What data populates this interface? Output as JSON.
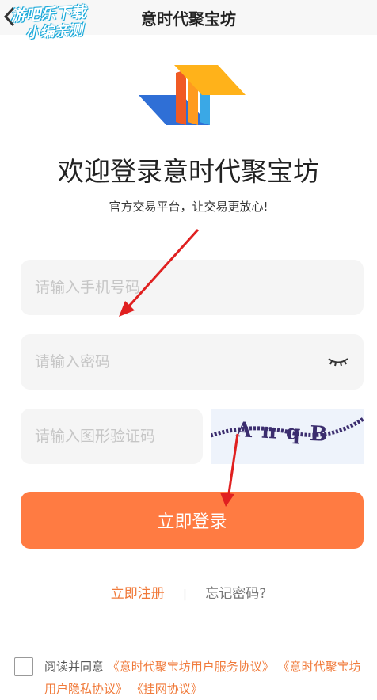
{
  "header": {
    "title": "意时代聚宝坊",
    "watermark_line1": "游吧乐下载",
    "watermark_line2": "小编亲测"
  },
  "hero": {
    "welcome": "欢迎登录意时代聚宝坊",
    "subtitle": "官方交易平台，让交易更放心!"
  },
  "form": {
    "phone_placeholder": "请输入手机号码",
    "password_placeholder": "请输入密码",
    "captcha_placeholder": "请输入图形验证码",
    "captcha_code": "AnqB",
    "login_label": "立即登录"
  },
  "links": {
    "register": "立即注册",
    "divider": "|",
    "forgot": "忘记密码?"
  },
  "agreement": {
    "prefix": "阅读并同意",
    "service": "《意时代聚宝坊用户服务协议》",
    "privacy": "《意时代聚宝坊用户隐私协议》",
    "listing": "《挂网协议》"
  },
  "colors": {
    "accent": "#ff7b42",
    "link": "#f07a3a",
    "field_bg": "#f5f5f5",
    "annotation_arrow": "#e02020"
  },
  "icons": [
    "back-icon",
    "app-logo-icon",
    "eye-closed-icon",
    "captcha-image",
    "checkbox"
  ]
}
